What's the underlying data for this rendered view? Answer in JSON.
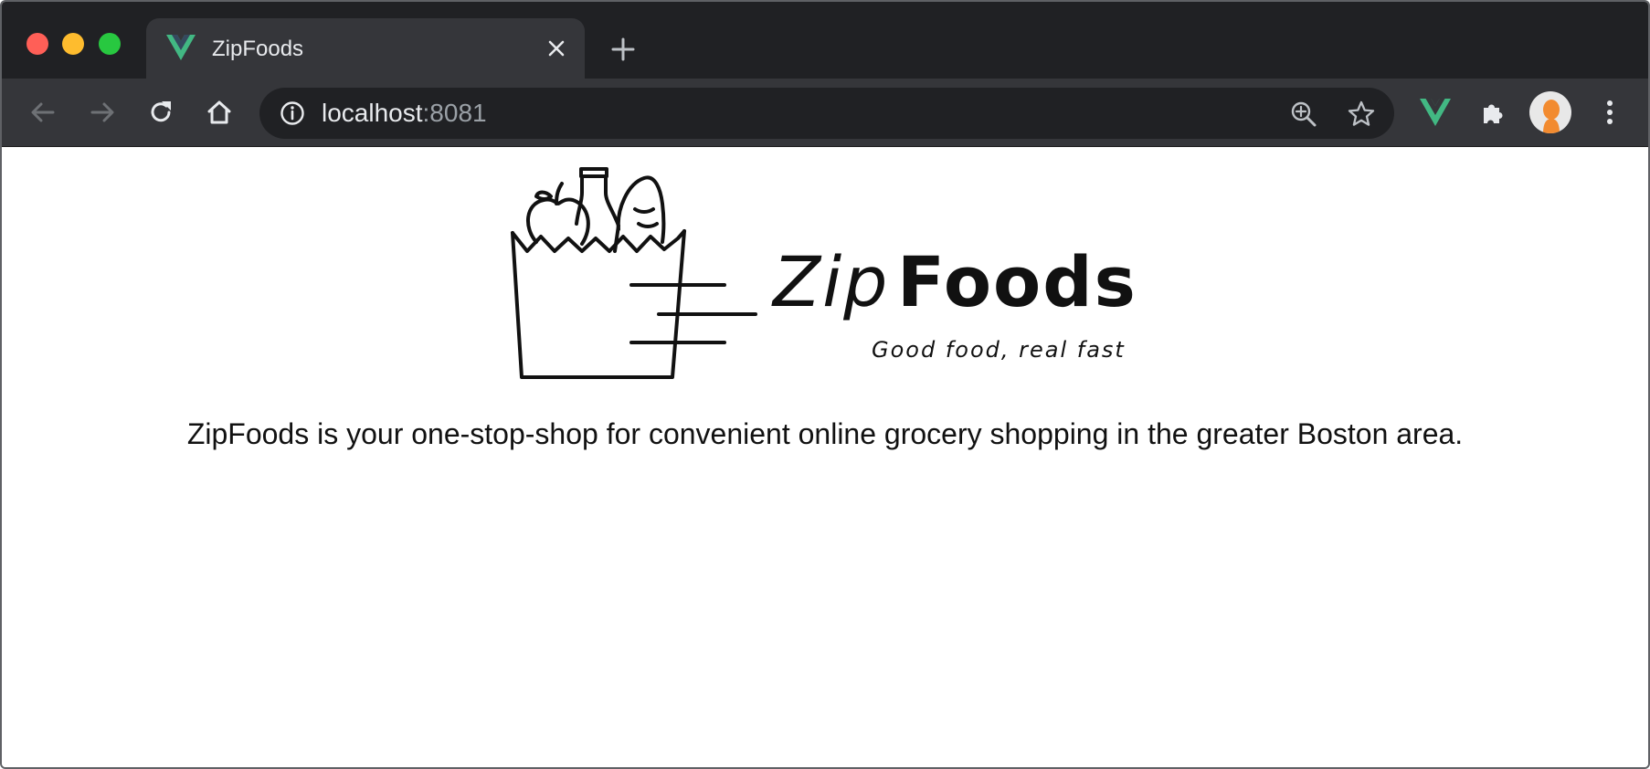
{
  "window": {
    "tab": {
      "title": "ZipFoods",
      "favicon": "vue-logo-icon"
    },
    "new_tab_icon": "plus-icon"
  },
  "toolbar": {
    "address": {
      "host": "localhost",
      "port": ":8081"
    },
    "icons": [
      "back-arrow-icon",
      "forward-arrow-icon",
      "reload-icon",
      "home-icon",
      "info-icon",
      "zoom-icon",
      "star-icon",
      "vue-devtools-icon",
      "extensions-icon",
      "profile-avatar",
      "more-menu-icon"
    ]
  },
  "logo": {
    "word_light": "Zip",
    "word_bold": "Foods",
    "tagline": "Good food, real fast"
  },
  "page": {
    "description": "ZipFoods is your one-stop-shop for convenient online grocery shopping in the greater Boston area."
  },
  "colors": {
    "tab_strip": "#202124",
    "toolbar": "#35363a",
    "omnibox": "#202124",
    "vue_green": "#42b883",
    "avatar_orange": "#f28b30"
  }
}
